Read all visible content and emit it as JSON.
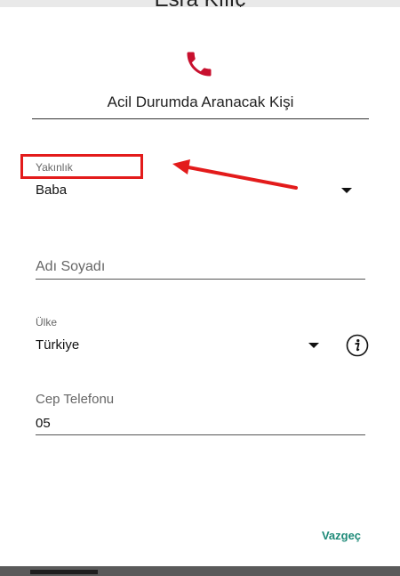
{
  "background_app": {
    "title": "Esra Kılıç"
  },
  "dialog": {
    "icon": "phone-icon",
    "title": "Acil Durumda Aranacak Kişi",
    "relationship": {
      "label": "Yakınlık",
      "value": "Baba"
    },
    "full_name": {
      "placeholder": "Adı Soyadı"
    },
    "country": {
      "label": "Ülke",
      "value": "Türkiye",
      "info_icon": "info-icon"
    },
    "mobile": {
      "label": "Cep Telefonu",
      "value": "05"
    },
    "cancel_label": "Vazgeç"
  },
  "colors": {
    "accent": "#1e8a78",
    "phone_icon": "#c8102e",
    "annotation": "#e31b1b"
  }
}
